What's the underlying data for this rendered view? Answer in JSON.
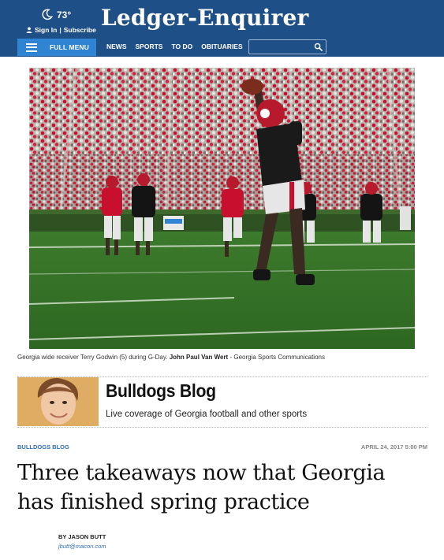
{
  "header": {
    "weather_icon": "moon-icon",
    "temperature": "73°",
    "sign_in": "Sign In",
    "separator": "|",
    "subscribe": "Subscribe",
    "logo": "Ledger-Enquirer",
    "full_menu": "FULL MENU",
    "nav": [
      "NEWS",
      "SPORTS",
      "TO DO",
      "OBITUARIES"
    ],
    "search_value": "",
    "colors": {
      "bar": "#1e4f87",
      "menu_button": "#2f84d3"
    }
  },
  "photo": {
    "caption": "Georgia wide receiver Terry Godwin (5) during G-Day.",
    "credit_name": "John Paul Van Wert",
    "credit_org": "- Georgia Sports Communications"
  },
  "blog": {
    "title": "Bulldogs Blog",
    "description": "Live coverage of Georgia football and other sports"
  },
  "article": {
    "kicker": "BULLDOGS BLOG",
    "date": "APRIL 24, 2017 5:00 PM",
    "headline": "Three takeaways now that Georgia has finished spring practice",
    "byline": "BY JASON BUTT",
    "email": "jbutt@macon.com",
    "colors": {
      "link": "#2f6fb3"
    }
  }
}
